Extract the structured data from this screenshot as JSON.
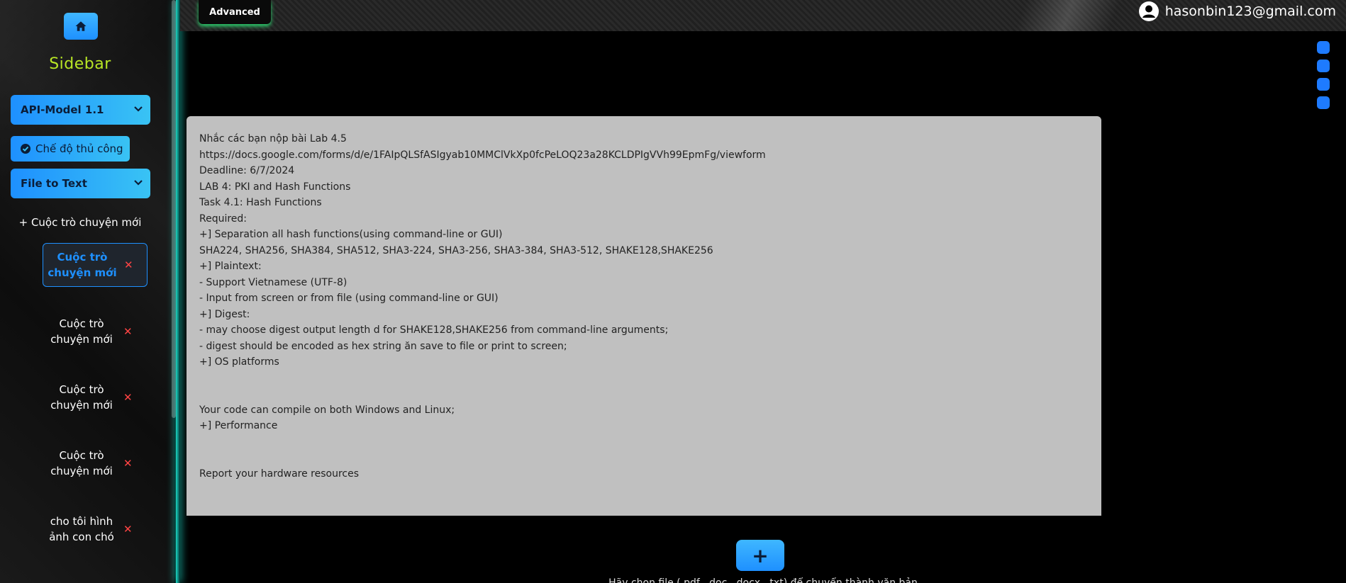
{
  "sidebar": {
    "title": "Sidebar",
    "model_select": "API-Model 1.1",
    "manual_mode_label": "Chế độ thủ công",
    "mode_select": "File to Text",
    "new_chat_label": "+ Cuộc trò chuyện mới",
    "chats": [
      {
        "label": "Cuộc trò chuyện mới",
        "active": true
      },
      {
        "label": "Cuộc trò chuyện mới",
        "active": false
      },
      {
        "label": "Cuộc trò chuyện mới",
        "active": false
      },
      {
        "label": "Cuộc trò chuyện mới",
        "active": false
      },
      {
        "label": "cho tôi hình ảnh con chó",
        "active": false
      }
    ],
    "delete_glyph": "✕"
  },
  "header": {
    "advanced_tab": "Advanced",
    "user_email": "hasonbin123@gmail.com"
  },
  "content": {
    "lines": [
      "Nhắc các bạn nộp bài Lab 4.5",
      "https://docs.google.com/forms/d/e/1FAIpQLSfASIgyab10MMClVkXp0fcPeLOQ23a28KCLDPIgVVh99EpmFg/viewform",
      "Deadline: 6/7/2024",
      "LAB 4: PKI and Hash Functions",
      "Task 4.1: Hash Functions",
      "Required:",
      "+] Separation all hash functions(using command-line or GUI)",
      "SHA224, SHA256, SHA384, SHA512, SHA3-224, SHA3-256, SHA3-384, SHA3-512, SHAKE128,SHAKE256",
      "+] Plaintext:",
      "- Support Vietnamese (UTF-8)",
      "- Input from screen or from file (using command-line or GUI)",
      "+] Digest:",
      "- may choose digest output length d for SHAKE128,SHAKE256 from command-line arguments;",
      "- digest should be encoded as hex string ăn save to file or print to screen;",
      "+] OS platforms",
      "",
      "",
      "Your code can compile on both Windows and Linux;",
      "+] Performance",
      "",
      "",
      "Report your hardware resources"
    ],
    "add_button": "+",
    "bottom_hint": "Hãy chọn file (.pdf, .doc, .docx, .txt) để chuyển thành văn bản"
  },
  "colors": {
    "accent": "#1e90ff",
    "sidebar_title": "#b8e625",
    "delete": "#ff4444",
    "content_bg": "#c0c0c0",
    "glow": "#1dd8c4"
  }
}
